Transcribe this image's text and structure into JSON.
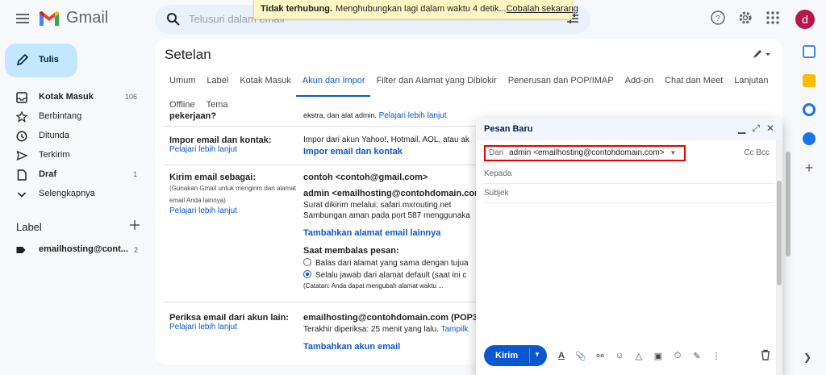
{
  "app": {
    "name": "Gmail",
    "avatar_letter": "d",
    "avatar_color": "#b5174a"
  },
  "search": {
    "placeholder": "Telusuri dalam email"
  },
  "toast": {
    "bold": "Tidak terhubung.",
    "text": "Menghubungkan lagi dalam waktu 4 detik...",
    "link": "Cobalah sekarang"
  },
  "compose_button": "Tulis",
  "nav": [
    {
      "label": "Kotak Masuk",
      "count": "106",
      "icon": "inbox-icon",
      "bold": true
    },
    {
      "label": "Berbintang",
      "count": "",
      "icon": "star-icon",
      "bold": false
    },
    {
      "label": "Ditunda",
      "count": "",
      "icon": "clock-icon",
      "bold": false
    },
    {
      "label": "Terkirim",
      "count": "",
      "icon": "send-icon",
      "bold": false
    },
    {
      "label": "Draf",
      "count": "1",
      "icon": "draft-icon",
      "bold": true
    },
    {
      "label": "Selengkapnya",
      "count": "",
      "icon": "chevron-down-icon",
      "bold": false
    }
  ],
  "labels": {
    "heading": "Label",
    "items": [
      {
        "label": "emailhosting@cont...",
        "count": "2"
      }
    ]
  },
  "settings": {
    "title": "Setelan",
    "tabs": [
      "Umum",
      "Label",
      "Kotak Masuk",
      "Akun dan Impor",
      "Filter dan Alamat yang Diblokir",
      "Penerusan dan POP/IMAP",
      "Add-on",
      "Chat dan Meet",
      "Lanjutan"
    ],
    "tabs2": [
      "Offline",
      "Tema"
    ],
    "active_tab": "Akun dan Impor",
    "cut_top_left": "pekerjaan?",
    "cut_top_right": "ekstra, dan alat admin.",
    "cut_top_link": "Pelajari lebih lanjut",
    "import": {
      "title": "Impor email dan kontak:",
      "learn": "Pelajari lebih lanjut",
      "desc": "Impor dari akun Yahoo!, Hotmail, AOL, atau ak",
      "action": "Impor email dan kontak"
    },
    "send_as": {
      "title": "Kirim email sebagai:",
      "note": "(Gunakan Gmail untuk mengirim dari alamat email Anda lainnya)",
      "learn": "Pelajari lebih lanjut",
      "address1": "contoh <contoh@gmail.com>",
      "address2": "admin <emailhosting@contohdomain.com",
      "via": "Surat dikirim melalui: safari.mxrouting.net",
      "secure": "Sambungan aman pada port 587 menggunaka",
      "add": "Tambahkan alamat email lainnya",
      "reply_title": "Saat membalas pesan:",
      "reply_opt1": "Balas dari alamat yang sama dengan tujua",
      "reply_opt2": "Selalu jawab dari alamat default (saat ini c",
      "reply_note": "(Catatan: Anda dapat mengubah alamat waktu ..."
    },
    "check_mail": {
      "title": "Periksa email dari akun lain:",
      "learn": "Pelajari lebih lanjut",
      "account": "emailhosting@contohdomain.com (POP3)",
      "last_checked": "Terakhir diperiksa: 25 menit yang lalu.",
      "last_link": "Tampilk",
      "add": "Tambahkan akun email"
    }
  },
  "compose": {
    "title": "Pesan Baru",
    "from_label": "Dari",
    "from_value": "admin <emailhosting@contohdomain.com>",
    "cc_bcc": "Cc Bcc",
    "to_placeholder": "Kepada",
    "subject_placeholder": "Subjek",
    "send_label": "Kirim"
  }
}
